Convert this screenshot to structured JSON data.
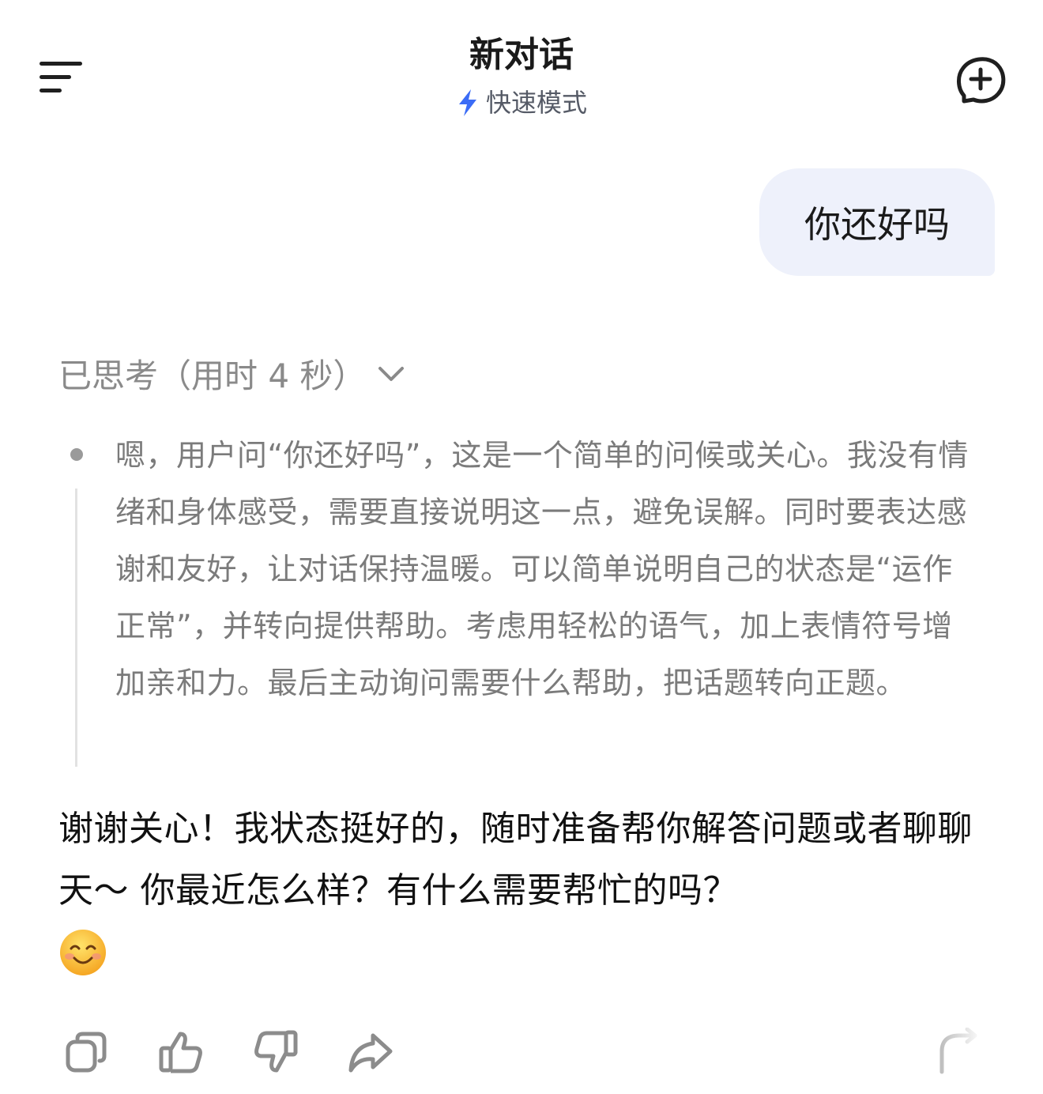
{
  "header": {
    "title": "新对话",
    "mode_label": "快速模式",
    "menu_icon": "menu-icon",
    "new_chat_icon": "new-chat-icon",
    "accent_color": "#3b6cf6"
  },
  "conversation": {
    "user_message": "你还好吗",
    "thinking": {
      "toggle_label": "已思考（用时 4 秒）",
      "content": "嗯，用户问“你还好吗”，这是一个简单的问候或关心。我没有情绪和身体感受，需要直接说明这一点，避免误解。同时要表达感谢和友好，让对话保持温暖。可以简单说明自己的状态是“运作正常”，并转向提供帮助。考虑用轻松的语气，加上表情符号增加亲和力。最后主动询问需要什么帮助，把话题转向正题。"
    },
    "answer_text": "谢谢关心！我状态挺好的，随时准备帮你解答问题或者聊聊天～ 你最近怎么样？有什么需要帮忙的吗？",
    "answer_emoji": "smiling-face-emoji"
  },
  "actions": [
    {
      "name": "copy",
      "icon": "copy-icon"
    },
    {
      "name": "like",
      "icon": "thumbs-up-icon"
    },
    {
      "name": "dislike",
      "icon": "thumbs-down-icon"
    },
    {
      "name": "share",
      "icon": "share-icon"
    },
    {
      "name": "regenerate",
      "icon": "regenerate-icon"
    }
  ]
}
